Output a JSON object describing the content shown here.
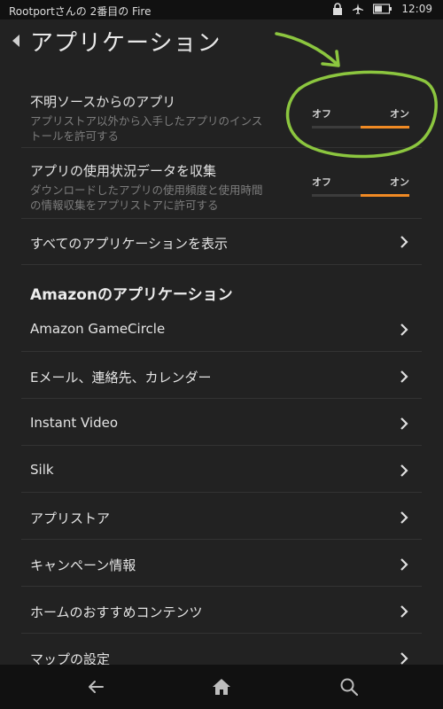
{
  "status_bar": {
    "device_name": "Rootportさんの 2番目の Fire",
    "time": "12:09"
  },
  "header": {
    "title": "アプリケーション"
  },
  "settings": {
    "unknown_sources": {
      "label": "不明ソースからのアプリ",
      "description_line1": "アプリストア以外から入手したアプリのインス",
      "description_line2": "トールを許可する",
      "off_label": "オフ",
      "on_label": "オン",
      "state": "on"
    },
    "usage_data": {
      "label": "アプリの使用状況データを収集",
      "description_line1": "ダウンロードしたアプリの使用頻度と使用時間",
      "description_line2": "の情報収集をアプリストアに許可する",
      "off_label": "オフ",
      "on_label": "オン",
      "state": "on"
    },
    "show_all_apps": {
      "label": "すべてのアプリケーションを表示"
    }
  },
  "amazon_section": {
    "title": "Amazonのアプリケーション",
    "items": [
      {
        "label": "Amazon GameCircle"
      },
      {
        "label": "Eメール、連絡先、カレンダー"
      },
      {
        "label": "Instant Video"
      },
      {
        "label": "Silk"
      },
      {
        "label": "アプリストア"
      },
      {
        "label": "キャンペーン情報"
      },
      {
        "label": "ホームのおすすめコンテンツ"
      },
      {
        "label": "マップの設定"
      }
    ]
  },
  "colors": {
    "background": "#222222",
    "accent_orange": "#f08a24",
    "annotation_green": "#8cc63f"
  },
  "icons": [
    "back-icon",
    "lock-icon",
    "airplane-icon",
    "battery-icon",
    "chevron-right-icon",
    "nav-back-icon",
    "home-icon",
    "search-icon"
  ]
}
